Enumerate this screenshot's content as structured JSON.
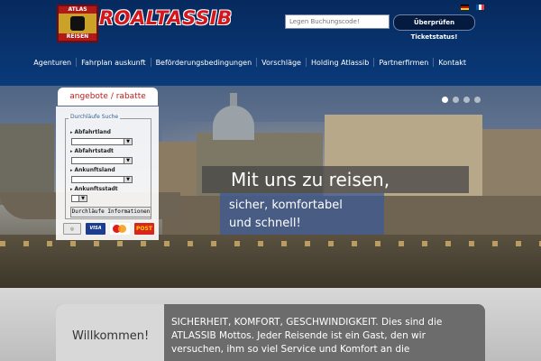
{
  "header": {
    "logo_badge_top": "ATLAS",
    "logo_badge_bottom": "REISEN",
    "logo_text": "ROALTASSIB",
    "booking_placeholder": "Legen Buchungscode!",
    "booking_button": "Überprüfen Ticketstatus!",
    "languages": [
      "de",
      "fr"
    ]
  },
  "nav": {
    "items": [
      "Agenturen",
      "Fahrplan auskunft",
      "Beförderungsbedingungen",
      "Vorschläge",
      "Holding Atlassib",
      "Partnerfirmen",
      "Kontakt"
    ]
  },
  "hero": {
    "slogan_line1": "Mit uns zu reisen,",
    "slogan_line2a": "sicher, komfortabel",
    "slogan_line2b": "und schnell!",
    "slide_count": 4,
    "active_slide": 1
  },
  "sidebar": {
    "tab_label": "angebote / rabatte",
    "search": {
      "legend": "Durchläufe Suche",
      "fields": [
        {
          "label": "Abfahrtland",
          "value": ""
        },
        {
          "label": "Abfahrtstadt",
          "value": ""
        },
        {
          "label": "Ankunftsland",
          "value": ""
        },
        {
          "label": "Ankunftsstadt",
          "value": ""
        }
      ],
      "button": "Durchläufe Informationen"
    },
    "payments": [
      "VISA",
      "POST"
    ]
  },
  "welcome": {
    "title": "Willkommen!",
    "text": "SICHERHEIT, KOMFORT, GESCHWINDIGKEIT. Dies sind die ATLASSIB Mottos. Jeder Reisende ist ein Gast, den wir versuchen, ihm so viel Service und Komfort an die"
  },
  "colors": {
    "header_bg": "#062a5e",
    "accent_red": "#c51a1a",
    "booking_btn": "#041a3f"
  }
}
